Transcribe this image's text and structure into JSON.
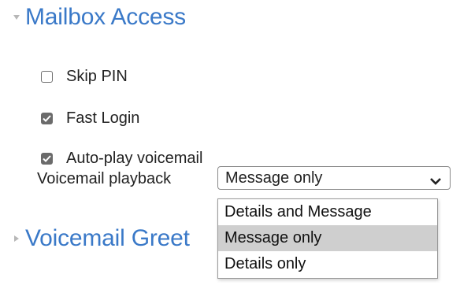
{
  "sections": {
    "mailbox_access": {
      "title": "Mailbox Access",
      "expanded": true
    },
    "voicemail_greeting": {
      "title": "Voicemail Greet",
      "expanded": false
    }
  },
  "options": {
    "skip_pin": {
      "label": "Skip PIN",
      "checked": false
    },
    "fast_login": {
      "label": "Fast Login",
      "checked": true
    },
    "auto_play": {
      "label": "Auto-play voicemail",
      "checked": true
    }
  },
  "playback": {
    "label": "Voicemail playback",
    "selected": "Message only",
    "options": [
      "Details and Message",
      "Message only",
      "Details only"
    ]
  },
  "colors": {
    "section_title": "#3a79c8",
    "checkbox_checked": "#6b6b6b",
    "highlight": "#cfcfcf"
  }
}
